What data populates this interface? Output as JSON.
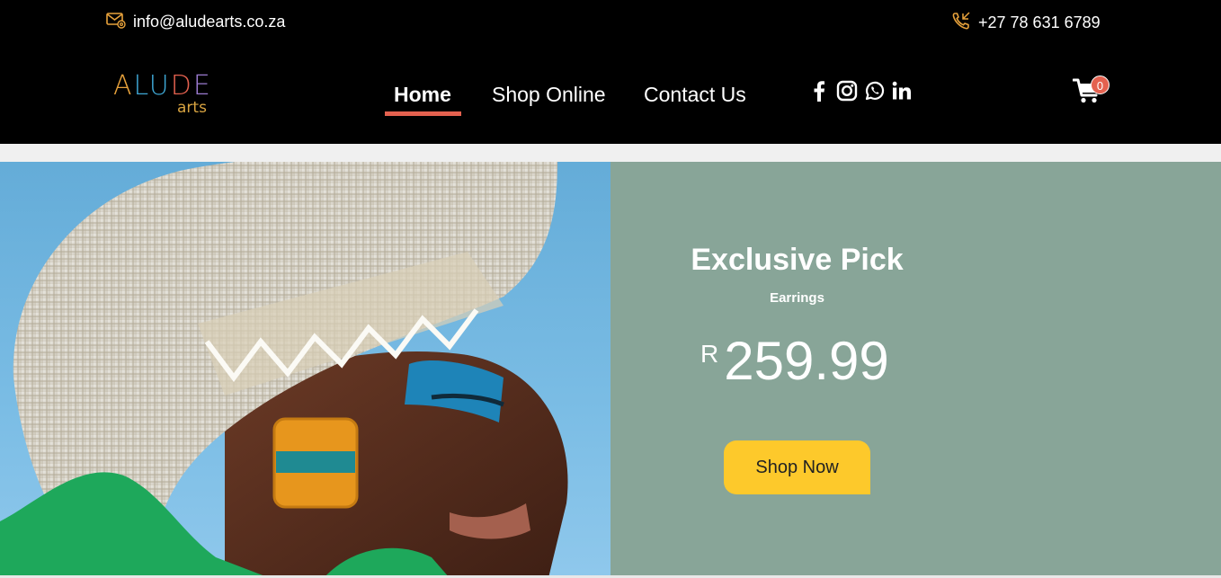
{
  "topbar": {
    "email": "info@aludearts.co.za",
    "phone": "+27 78 631 6789"
  },
  "logo": {
    "letters": [
      "A",
      "L",
      "U",
      "D",
      "E"
    ],
    "letter_colors": [
      "#e8a23b",
      "#3fa8d6",
      "#3fa8d6",
      "#e4614f",
      "#9c7bd1"
    ],
    "sub": "arts"
  },
  "nav": {
    "items": [
      {
        "label": "Home",
        "active": true
      },
      {
        "label": "Shop Online",
        "active": false
      },
      {
        "label": "Contact Us",
        "active": false
      }
    ]
  },
  "socials": [
    "facebook-icon",
    "instagram-icon",
    "whatsapp-icon",
    "linkedin-icon"
  ],
  "cart": {
    "count": "0"
  },
  "hero": {
    "title": "Exclusive Pick",
    "subtitle": "Earrings",
    "currency": "R",
    "price": "259.99",
    "cta": "Shop Now"
  },
  "colors": {
    "header_bg": "#000000",
    "accent": "#e4614f",
    "panel_bg": "#88a598",
    "cta_bg": "#fdc92b",
    "icon_gold": "#e8a23b"
  }
}
